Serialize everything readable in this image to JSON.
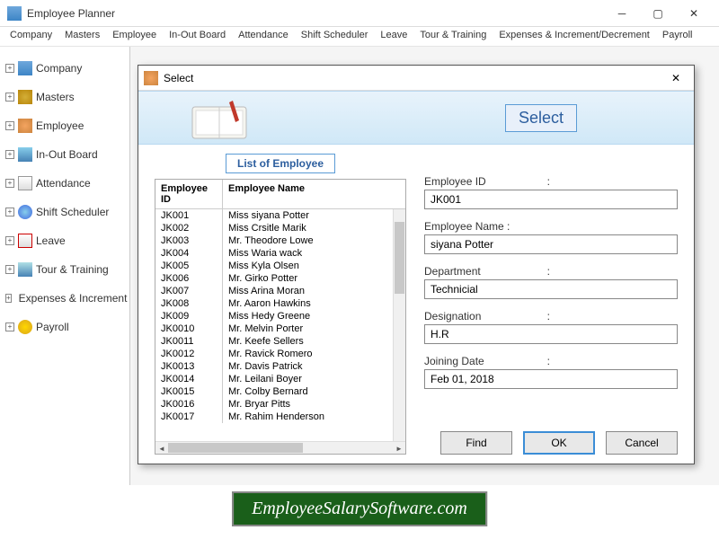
{
  "window": {
    "title": "Employee Planner"
  },
  "menu": [
    "Company",
    "Masters",
    "Employee",
    "In-Out Board",
    "Attendance",
    "Shift Scheduler",
    "Leave",
    "Tour & Training",
    "Expenses & Increment/Decrement",
    "Payroll"
  ],
  "sidebar": [
    {
      "label": "Company",
      "icon": "building-icon"
    },
    {
      "label": "Masters",
      "icon": "gears-icon"
    },
    {
      "label": "Employee",
      "icon": "people-icon"
    },
    {
      "label": "In-Out Board",
      "icon": "arrow-icon"
    },
    {
      "label": "Attendance",
      "icon": "calendar-icon"
    },
    {
      "label": "Shift Scheduler",
      "icon": "clock-icon"
    },
    {
      "label": "Leave",
      "icon": "leave-icon"
    },
    {
      "label": "Tour & Training",
      "icon": "plane-icon"
    },
    {
      "label": "Expenses & Increment",
      "icon": "money-icon"
    },
    {
      "label": "Payroll",
      "icon": "coin-icon"
    }
  ],
  "modal": {
    "title": "Select",
    "banner_label": "Select",
    "list_header": "List of Employee",
    "columns": {
      "id": "Employee ID",
      "name": "Employee Name"
    },
    "rows": [
      {
        "id": "JK001",
        "name": "Miss siyana Potter"
      },
      {
        "id": "JK002",
        "name": "Miss Crsitle Marik"
      },
      {
        "id": "JK003",
        "name": "Mr. Theodore Lowe"
      },
      {
        "id": "JK004",
        "name": "Miss Waria wack"
      },
      {
        "id": "JK005",
        "name": "Miss Kyla Olsen"
      },
      {
        "id": "JK006",
        "name": "Mr. Girko Potter"
      },
      {
        "id": "JK007",
        "name": "Miss Arina Moran"
      },
      {
        "id": "JK008",
        "name": "Mr. Aaron Hawkins"
      },
      {
        "id": "JK009",
        "name": "Miss Hedy Greene"
      },
      {
        "id": "JK0010",
        "name": "Mr. Melvin Porter"
      },
      {
        "id": "JK0011",
        "name": "Mr. Keefe Sellers"
      },
      {
        "id": "JK0012",
        "name": "Mr. Ravick Romero"
      },
      {
        "id": "JK0013",
        "name": "Mr. Davis Patrick"
      },
      {
        "id": "JK0014",
        "name": "Mr. Leilani Boyer"
      },
      {
        "id": "JK0015",
        "name": "Mr. Colby Bernard"
      },
      {
        "id": "JK0016",
        "name": "Mr. Bryar Pitts"
      },
      {
        "id": "JK0017",
        "name": "Mr. Rahim Henderson"
      }
    ],
    "fields": {
      "emp_id": {
        "label": "Employee ID",
        "value": "JK001"
      },
      "emp_name": {
        "label": "Employee Name :",
        "value": "siyana Potter"
      },
      "dept": {
        "label": "Department",
        "value": "Technicial"
      },
      "desig": {
        "label": "Designation",
        "value": "H.R"
      },
      "join": {
        "label": "Joining Date",
        "value": "Feb 01, 2018"
      }
    },
    "buttons": {
      "find": "Find",
      "ok": "OK",
      "cancel": "Cancel"
    }
  },
  "footer": "EmployeeSalarySoftware.com"
}
